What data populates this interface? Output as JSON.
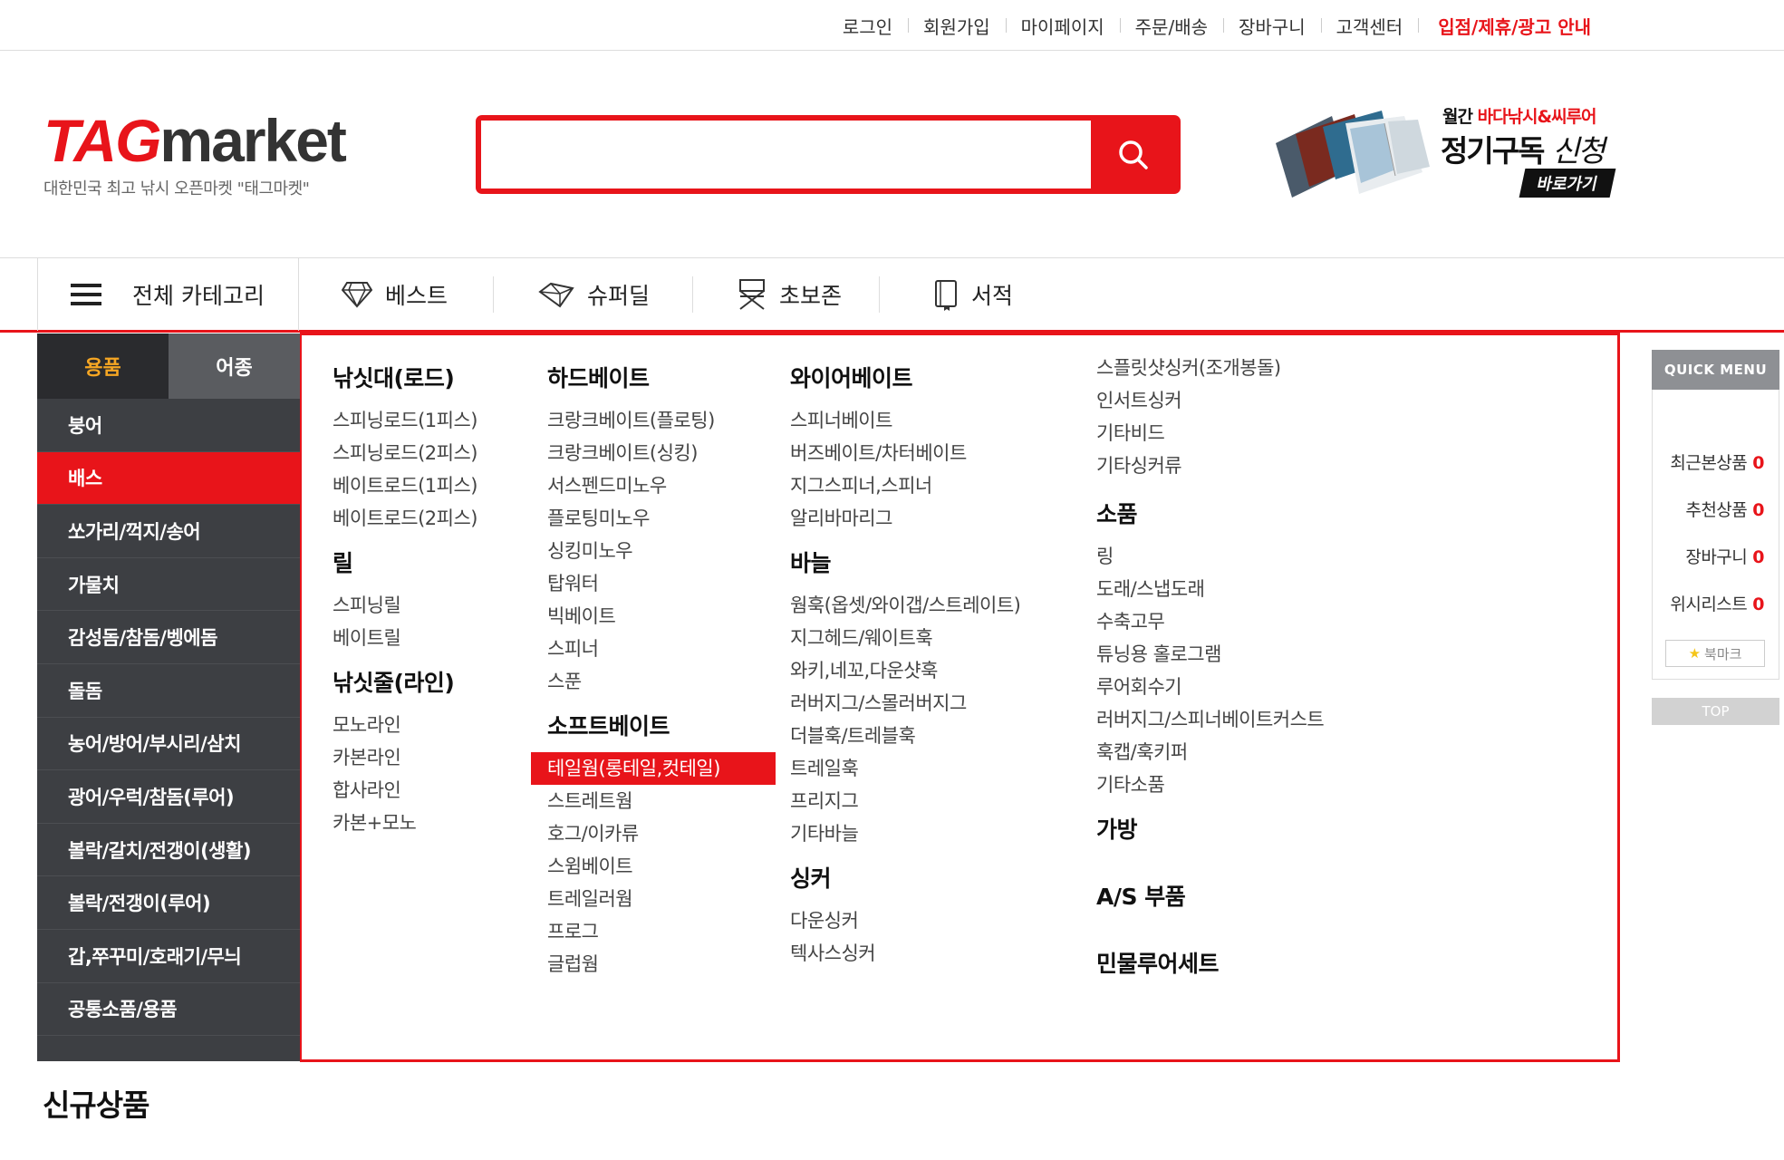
{
  "util": {
    "links": [
      "로그인",
      "회원가입",
      "마이페이지",
      "주문/배송",
      "장바구니",
      "고객센터"
    ],
    "accent_link": "입점/제휴/광고 안내"
  },
  "logo": {
    "tag": "TAG",
    "market": "market",
    "sub": "대한민국 최고 낚시 오픈마켓 \"태그마켓\""
  },
  "search": {
    "value": "",
    "placeholder": ""
  },
  "promo": {
    "line1_dark": "월간",
    "line1_red": "바다낚시&씨루어",
    "line2_bold": "정기구독",
    "line2_light": "신청",
    "button": "바로가기"
  },
  "nav": {
    "all_label": "전체 카테고리",
    "items": [
      "베스트",
      "슈퍼딜",
      "초보존",
      "서적"
    ]
  },
  "side": {
    "tabs": [
      "용품",
      "어종"
    ],
    "items": [
      "붕어",
      "배스",
      "쏘가리/꺽지/송어",
      "가물치",
      "감성돔/참돔/벵에돔",
      "돌돔",
      "농어/방어/부시리/삼치",
      "광어/우럭/참돔(루어)",
      "볼락/갈치/전갱이(생활)",
      "볼락/전갱이(루어)",
      "갑,쭈꾸미/호래기/무늬",
      "공통소품/용품"
    ]
  },
  "mega": {
    "col1": [
      {
        "title": "낚싯대(로드)",
        "items": [
          "스피닝로드(1피스)",
          "스피닝로드(2피스)",
          "베이트로드(1피스)",
          "베이트로드(2피스)"
        ]
      },
      {
        "title": "릴",
        "items": [
          "스피닝릴",
          "베이트릴"
        ]
      },
      {
        "title": "낚싯줄(라인)",
        "items": [
          "모노라인",
          "카본라인",
          "합사라인",
          "카본+모노"
        ]
      }
    ],
    "col2": [
      {
        "title": "하드베이트",
        "items": [
          "크랑크베이트(플로팅)",
          "크랑크베이트(싱킹)",
          "서스펜드미노우",
          "플로팅미노우",
          "싱킹미노우",
          "탑워터",
          "빅베이트",
          "스피너",
          "스푼"
        ]
      },
      {
        "title": "소프트베이트",
        "items": [
          "테일웜(롱테일,컷테일)",
          "스트레트웜",
          "호그/이카류",
          "스윔베이트",
          "트레일러웜",
          "프로그",
          "글럽웜"
        ]
      }
    ],
    "col3": [
      {
        "title": "와이어베이트",
        "items": [
          "스피너베이트",
          "버즈베이트/차터베이트",
          "지그스피너,스피너",
          "알리바마리그"
        ]
      },
      {
        "title": "바늘",
        "items": [
          "웜훅(옵셋/와이갭/스트레이트)",
          "지그헤드/웨이트훅",
          "와키,네꼬,다운샷훅",
          "러버지그/스몰러버지그",
          "더블훅/트레블훅",
          "트레일훅",
          "프리지그",
          "기타바늘"
        ]
      },
      {
        "title": "싱커",
        "items": [
          "다운싱커",
          "텍사스싱커"
        ]
      }
    ],
    "col4_top": [
      "스플릿샷싱커(조개봉돌)",
      "인서트싱커",
      "기타비드",
      "기타싱커류"
    ],
    "col4": [
      {
        "title": "소품",
        "items": [
          "링",
          "도래/스냅도래",
          "수축고무",
          "튜닝용 홀로그램",
          "루어회수기",
          "러버지그/스피너베이트커스트",
          "훅캡/훅키퍼",
          "기타소품"
        ]
      },
      {
        "title": "가방",
        "items": []
      },
      {
        "title": "A/S 부품",
        "items": []
      },
      {
        "title": "민물루어세트",
        "items": []
      }
    ],
    "highlighted": "테일웜(롱테일,컷테일)"
  },
  "quick": {
    "title": "QUICK MENU",
    "rows": [
      {
        "label": "최근본상품",
        "count": "0"
      },
      {
        "label": "추천상품",
        "count": "0"
      },
      {
        "label": "장바구니",
        "count": "0"
      },
      {
        "label": "위시리스트",
        "count": "0"
      }
    ],
    "bookmark": "북마크",
    "top": "TOP"
  },
  "section_title": "신규상품",
  "colors": {
    "accent": "#e8141a",
    "sidebar": "#3d3f43",
    "tab_active_text": "#f5a623"
  }
}
